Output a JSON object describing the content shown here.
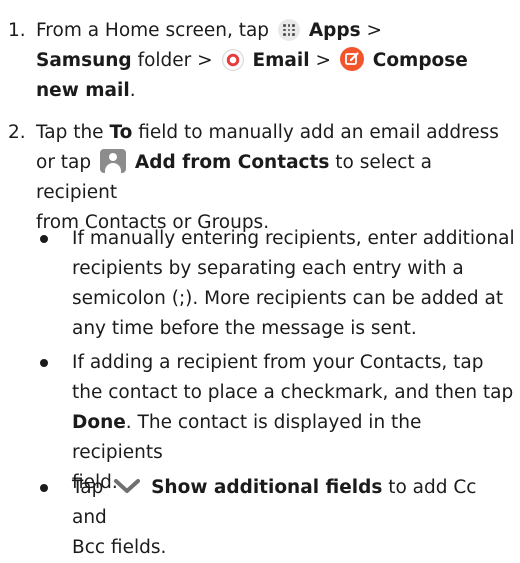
{
  "steps": [
    {
      "number": "1.",
      "parts": {
        "a": "From a Home screen, tap",
        "apps": "Apps",
        "sep1": ">",
        "samsung": "Samsung",
        "folder": "folder",
        "sep2": ">",
        "email": "Email",
        "sep3": ">",
        "compose_line1": "Compose",
        "compose_line2": "new mail",
        "end": "."
      }
    },
    {
      "number": "2.",
      "parts": {
        "a": "Tap the",
        "to": "To",
        "b": "field to manually add an email address",
        "c": "or tap",
        "add_contacts": "Add from Contacts",
        "d": "to select a recipient",
        "e": "from Contacts or Groups."
      }
    }
  ],
  "bullets": [
    {
      "lines": [
        "If manually entering recipients, enter additional",
        "recipients by separating each entry with a",
        "semicolon (;). More recipients can be added at",
        "any time before the message is sent."
      ]
    },
    {
      "line1": "If adding a recipient from your Contacts, tap",
      "line2": "the contact to place a checkmark, and then tap",
      "done": "Done",
      "line3_rest": ". The contact is displayed in the recipients",
      "line4": "field."
    },
    {
      "tap": "Tap",
      "show_fields": "Show additional fields",
      "rest": "to add Cc and",
      "line2": "Bcc fields."
    }
  ],
  "icons": {
    "apps": "apps-grid-icon",
    "email": "email-app-icon",
    "compose": "compose-icon",
    "contacts": "contact-icon",
    "chevron": "chevron-down-icon"
  },
  "colors": {
    "text": "#1b1b1b",
    "compose_accent": "#f2552c",
    "email_accent": "#e63c3c",
    "contact_gray": "#8c8c8c"
  }
}
